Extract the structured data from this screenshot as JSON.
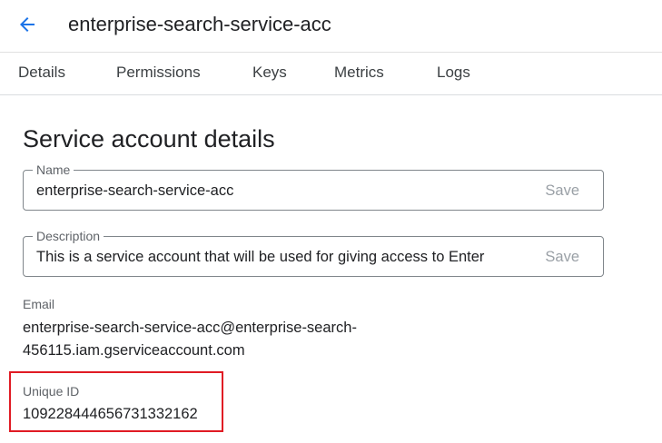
{
  "header": {
    "title": "enterprise-search-service-acc",
    "back_icon": "arrow-back-icon",
    "accent_color": "#1a73e8"
  },
  "tabs": [
    {
      "label": "Details"
    },
    {
      "label": "Permissions"
    },
    {
      "label": "Keys"
    },
    {
      "label": "Metrics"
    },
    {
      "label": "Logs"
    }
  ],
  "section": {
    "title": "Service account details"
  },
  "name_field": {
    "label": "Name",
    "value": "enterprise-search-service-acc",
    "save_label": "Save"
  },
  "description_field": {
    "label": "Description",
    "value": "This is a service account that will be used for giving access to Enter",
    "save_label": "Save"
  },
  "email": {
    "label": "Email",
    "line1": "enterprise-search-service-acc@enterprise-search-",
    "line2": "456115.iam.gserviceaccount.com"
  },
  "unique_id": {
    "label": "Unique ID",
    "value": "109228444656731332162",
    "highlight_color": "#e01b24"
  }
}
